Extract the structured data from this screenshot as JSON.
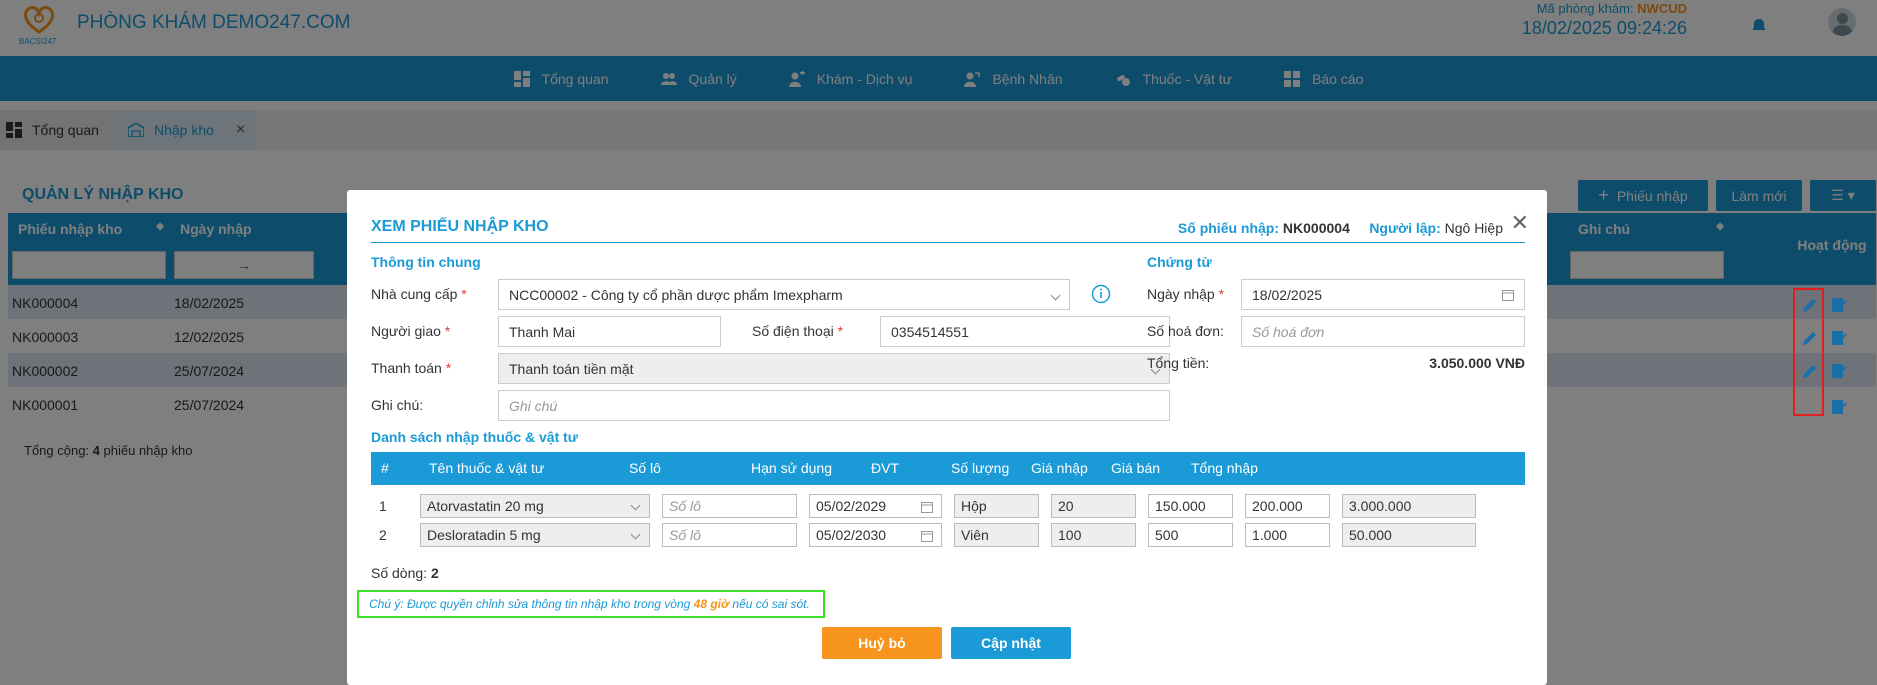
{
  "header": {
    "clinic_name": "PHÒNG KHÁM DEMO247.COM",
    "logo_text": "BACSI247",
    "clinic_code_label": "Mã phòng khám:",
    "clinic_code": "NWCUD",
    "datetime": "18/02/2025 09:24:26",
    "icons": [
      "logo-icon",
      "bell-icon",
      "avatar"
    ]
  },
  "nav": {
    "items": [
      {
        "label": "Tổng quan",
        "icon": "dashboard-icon"
      },
      {
        "label": "Quản lý",
        "icon": "users-icon"
      },
      {
        "label": "Khám - Dịch vụ",
        "icon": "medical-service-icon"
      },
      {
        "label": "Bệnh Nhân",
        "icon": "patient-icon"
      },
      {
        "label": "Thuốc - Vật tư",
        "icon": "medicine-icon"
      },
      {
        "label": "Báo cáo",
        "icon": "report-icon"
      }
    ]
  },
  "tabs": [
    {
      "label": "Tổng quan",
      "icon": "dashboard-icon"
    },
    {
      "label": "Nhập kho",
      "icon": "warehouse-icon"
    }
  ],
  "page": {
    "title": "QUẢN LÝ NHẬP KHO",
    "btn_new": "Phiếu nhập",
    "btn_refresh": "Làm mới",
    "columns": {
      "receipt": "Phiếu nhập kho",
      "date": "Ngày nhập",
      "note": "Ghi chú",
      "actions": "Hoạt động"
    },
    "date_range_arrow": "→",
    "rows": [
      {
        "code": "NK000004",
        "date": "18/02/2025"
      },
      {
        "code": "NK000003",
        "date": "12/02/2025"
      },
      {
        "code": "NK000002",
        "date": "25/07/2024"
      },
      {
        "code": "NK000001",
        "date": "25/07/2024"
      }
    ],
    "total_prefix": "Tổng cộng:",
    "total_count": "4",
    "total_suffix": "phiếu nhập kho"
  },
  "modal": {
    "title": "XEM PHIẾU NHẬP KHO",
    "receipt_no_label": "Số phiếu nhập:",
    "receipt_no": "NK000004",
    "creator_label": "Người lập:",
    "creator": "Ngô Hiệp",
    "general_section": "Thông tin chung",
    "supplier_label": "Nhà cung cấp",
    "supplier_value": "NCC00002 - Công ty cổ phần dược phẩm Imexpharm",
    "deliverer_label": "Người giao",
    "deliverer_value": "Thanh Mai",
    "phone_label": "Số điện thoại",
    "phone_value": "0354514551",
    "payment_label": "Thanh toán",
    "payment_value": "Thanh toán tiền mặt",
    "note_label": "Ghi chú:",
    "note_placeholder": "Ghi chú",
    "voucher_section": "Chứng từ",
    "import_date_label": "Ngày nhập",
    "import_date_value": "18/02/2025",
    "invoice_label": "Số hoá đơn:",
    "invoice_placeholder": "Số hoá đơn",
    "total_label": "Tổng tiền:",
    "total_value": "3.050.000 VNĐ",
    "list_section": "Danh sách nhập thuốc & vật tư",
    "grid_headers": [
      "#",
      "Tên thuốc & vật tư",
      "Số lô",
      "Hạn sử dụng",
      "ĐVT",
      "Số lượng",
      "Giá nhập",
      "Giá bán",
      "Tổng nhập"
    ],
    "items": [
      {
        "no": "1",
        "name": "Atorvastatin 20 mg",
        "lot_placeholder": "Số lô",
        "expiry": "05/02/2029",
        "unit": "Hộp",
        "qty": "20",
        "cost": "150.000",
        "price": "200.000",
        "total": "3.000.000"
      },
      {
        "no": "2",
        "name": "Desloratadin 5 mg",
        "lot_placeholder": "Số lô",
        "expiry": "05/02/2030",
        "unit": "Viên",
        "qty": "100",
        "cost": "500",
        "price": "1.000",
        "total": "50.000"
      }
    ],
    "rows_label": "Số dòng:",
    "rows_count": "2",
    "note_text_1": "Chú ý: Được quyền chỉnh sửa thông tin nhập kho trong vòng",
    "note_hours": "48 giờ",
    "note_text_2": "nếu có sai sót.",
    "btn_cancel": "Huỷ bỏ",
    "btn_update": "Cập nhật"
  },
  "colors": {
    "primary": "#1a9ad6",
    "accent": "#f7941d",
    "highlight_green": "#3adf2c",
    "highlight_red": "#e02020"
  }
}
